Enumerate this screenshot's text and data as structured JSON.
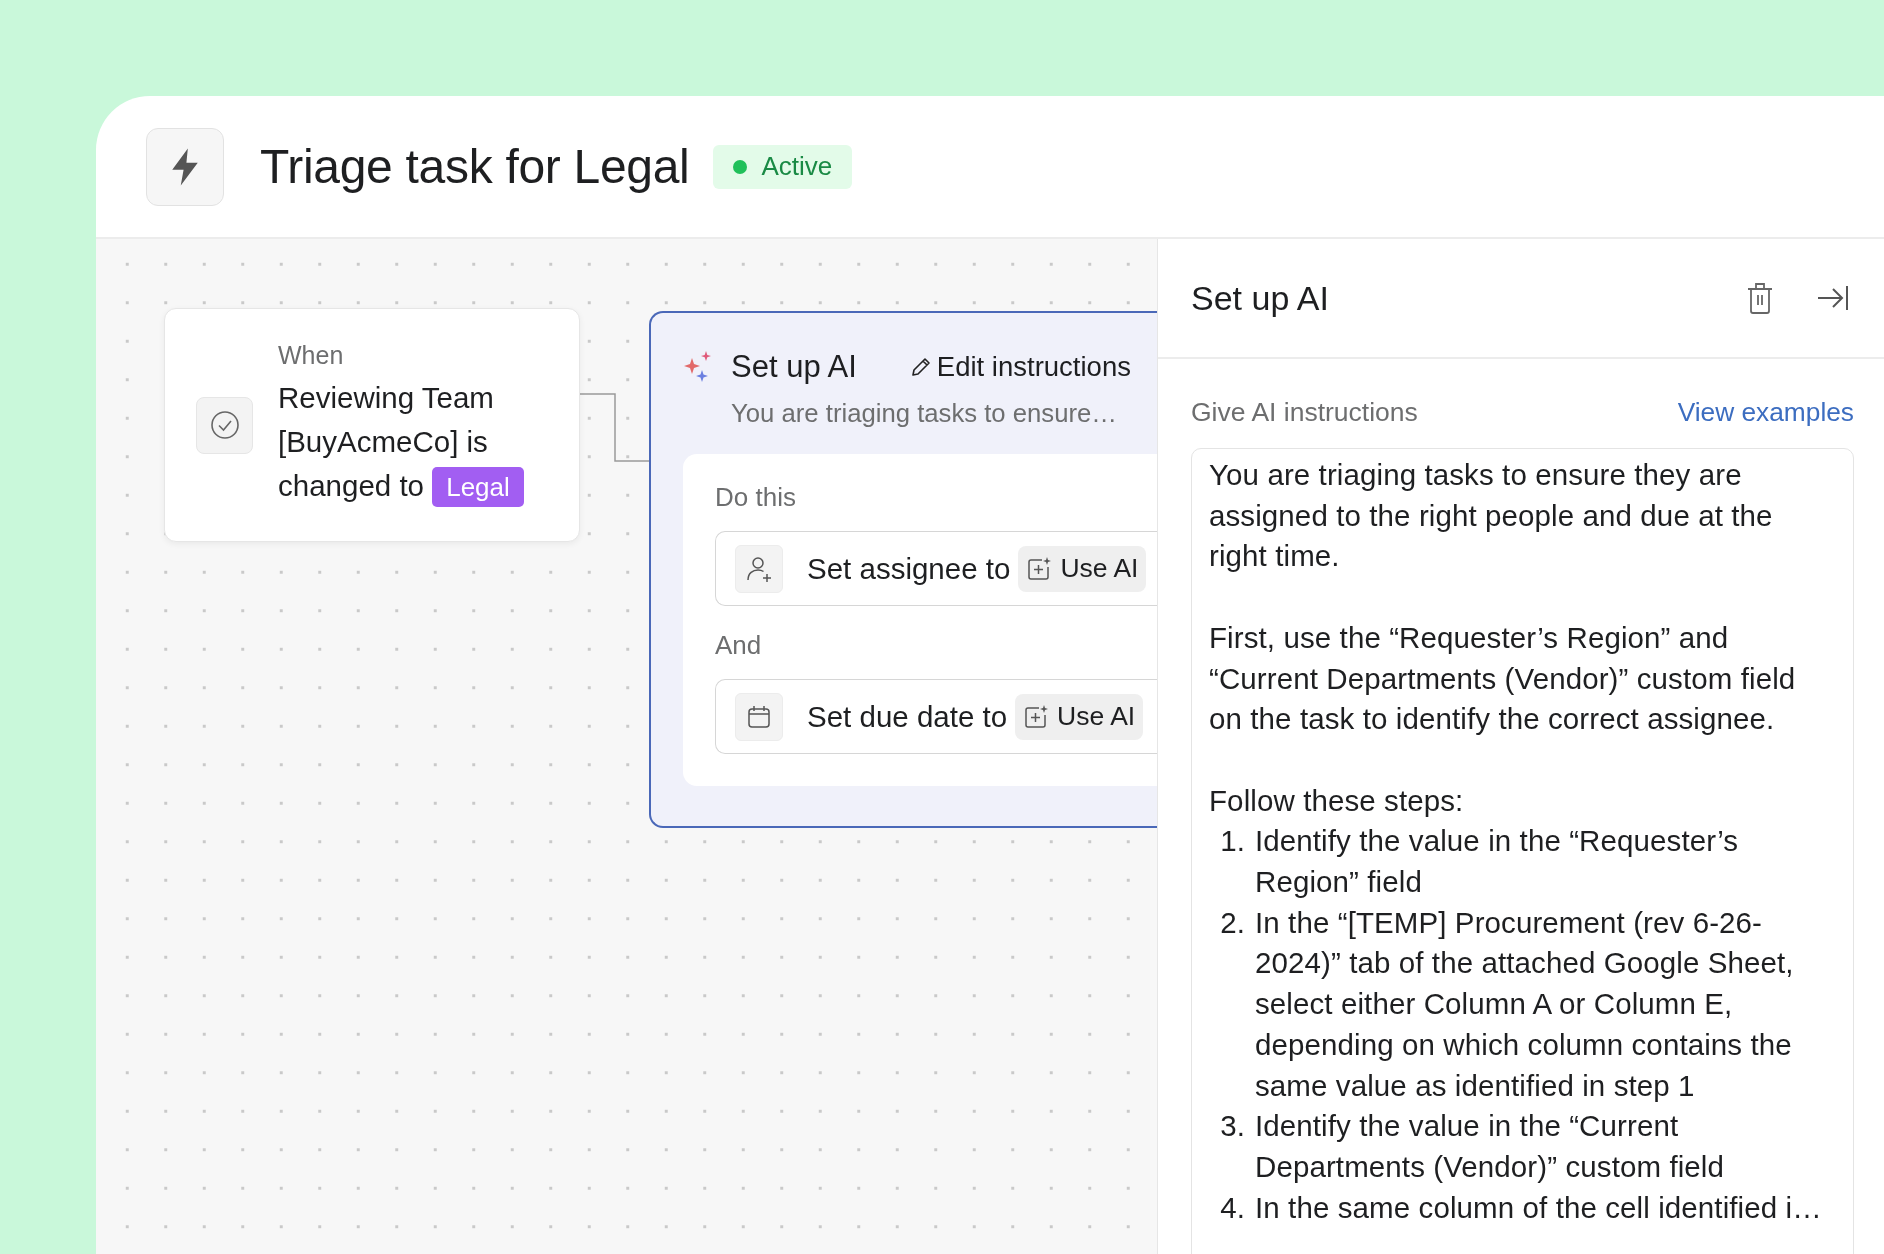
{
  "header": {
    "title": "Triage task for Legal",
    "status": {
      "label": "Active"
    }
  },
  "trigger_card": {
    "label": "When",
    "text": "Reviewing Team [BuyAcmeCo] is changed to",
    "tag": "Legal"
  },
  "ai_card": {
    "title": "Set up AI",
    "edit_link": "Edit instructions",
    "summary": "You are triaging tasks to ensure…",
    "sections": [
      {
        "label": "Do this",
        "action": {
          "kind": "assignee",
          "text": "Set assignee to",
          "chip": "Use AI"
        }
      },
      {
        "label": "And",
        "action": {
          "kind": "due_date",
          "text": "Set due date to",
          "chip": "Use AI"
        }
      }
    ]
  },
  "panel": {
    "title": "Set up AI",
    "field_label": "Give AI instructions",
    "examples_link": "View examples",
    "instructions": {
      "paragraphs": [
        "You are triaging tasks to ensure they are assigned to the right people and due at the right time.",
        "First, use the “Requester’s Region” and “Current Departments (Vendor)” custom field on the task to identify the correct assignee."
      ],
      "steps_intro": "Follow these steps:",
      "steps": [
        {
          "number": "1.",
          "text": "Identify the value in the “Requester’s Region” field"
        },
        {
          "number": "2.",
          "text": "In the “[TEMP] Procurement (rev 6-26-2024)” tab of the attached Google Sheet, select either Column A or Column E, depending on which column contains the same value as identified in step 1"
        },
        {
          "number": "3.",
          "text": "Identify the value in the “Current Departments (Vendor)” custom field"
        },
        {
          "number": "4.",
          "text": "In the same column of the cell identified i…"
        }
      ]
    }
  }
}
